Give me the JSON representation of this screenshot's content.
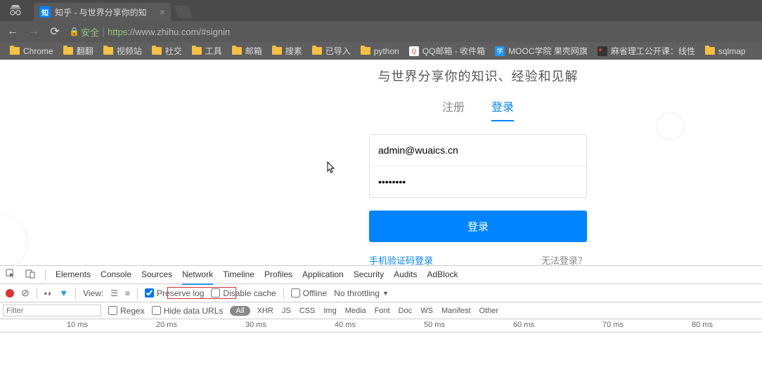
{
  "browser": {
    "tab_title": "知乎 - 与世界分享你的知",
    "favicon_text": "知",
    "url_secure": "安全",
    "url_proto": "https",
    "url_rest": "://www.zhihu.com/#signin"
  },
  "bookmarks": [
    {
      "type": "folder",
      "label": "Chrome"
    },
    {
      "type": "folder",
      "label": "翻翻"
    },
    {
      "type": "folder",
      "label": "视频站"
    },
    {
      "type": "folder",
      "label": "社交"
    },
    {
      "type": "folder",
      "label": "工具"
    },
    {
      "type": "folder",
      "label": "邮箱"
    },
    {
      "type": "folder",
      "label": "搜素"
    },
    {
      "type": "folder",
      "label": "已导入"
    },
    {
      "type": "folder",
      "label": "python"
    },
    {
      "type": "icon",
      "icon": "qq",
      "label": "QQ邮箱 - 收件箱"
    },
    {
      "type": "icon",
      "icon": "mooc",
      "label": "MOOC学院 果壳网旗"
    },
    {
      "type": "icon",
      "icon": "mit",
      "label": "麻省理工公开课：线性"
    },
    {
      "type": "folder",
      "label": "sqlmap"
    }
  ],
  "page": {
    "slogan": "与世界分享你的知识、经验和见解",
    "tab_register": "注册",
    "tab_login": "登录",
    "email_value": "admin@wuaics.cn",
    "password_value": "••••••••",
    "login_btn": "登录",
    "sms_login": "手机验证码登录",
    "forgot": "无法登录？"
  },
  "devtools": {
    "tabs": [
      "Elements",
      "Console",
      "Sources",
      "Network",
      "Timeline",
      "Profiles",
      "Application",
      "Security",
      "Audits",
      "AdBlock"
    ],
    "active_tab": "Network",
    "view_label": "View:",
    "preserve_log": "Preserve log",
    "disable_cache": "Disable cache",
    "offline": "Offline",
    "throttling": "No throttling",
    "filter_placeholder": "Filter",
    "regex": "Regex",
    "hide_data_urls": "Hide data URLs",
    "all": "All",
    "filter_types": [
      "XHR",
      "JS",
      "CSS",
      "Img",
      "Media",
      "Font",
      "Doc",
      "WS",
      "Manifest",
      "Other"
    ],
    "timeline_ticks": [
      "10 ms",
      "20 ms",
      "30 ms",
      "40 ms",
      "50 ms",
      "60 ms",
      "70 ms",
      "80 ms"
    ]
  }
}
